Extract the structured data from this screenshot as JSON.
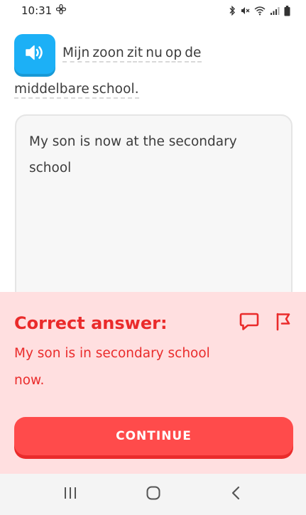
{
  "status_bar": {
    "time": "10:31",
    "icons": [
      "fan-icon",
      "bluetooth-icon",
      "mute-icon",
      "wifi-icon",
      "signal-icon",
      "battery-icon"
    ]
  },
  "prompt": {
    "line1_words": [
      "Mijn",
      "zoon",
      "zit",
      "nu",
      "op",
      "de"
    ],
    "line2_words": [
      "middelbare",
      "school."
    ],
    "speaker_icon": "speaker-icon"
  },
  "answer_box": {
    "value": "My son is now at the secondary school"
  },
  "feedback": {
    "title": "Correct answer:",
    "correct_text": "My son is in secondary school now.",
    "icons": [
      "discuss-icon",
      "flag-icon"
    ]
  },
  "continue_button": {
    "label": "CONTINUE"
  },
  "nav_bar": {
    "icons": [
      "recent-apps-icon",
      "home-icon",
      "back-icon"
    ]
  },
  "colors": {
    "accent_blue": "#1cb0f6",
    "error_red": "#ea2b2b",
    "button_red": "#ff4b4b",
    "feedback_bg": "#ffdfe0"
  }
}
